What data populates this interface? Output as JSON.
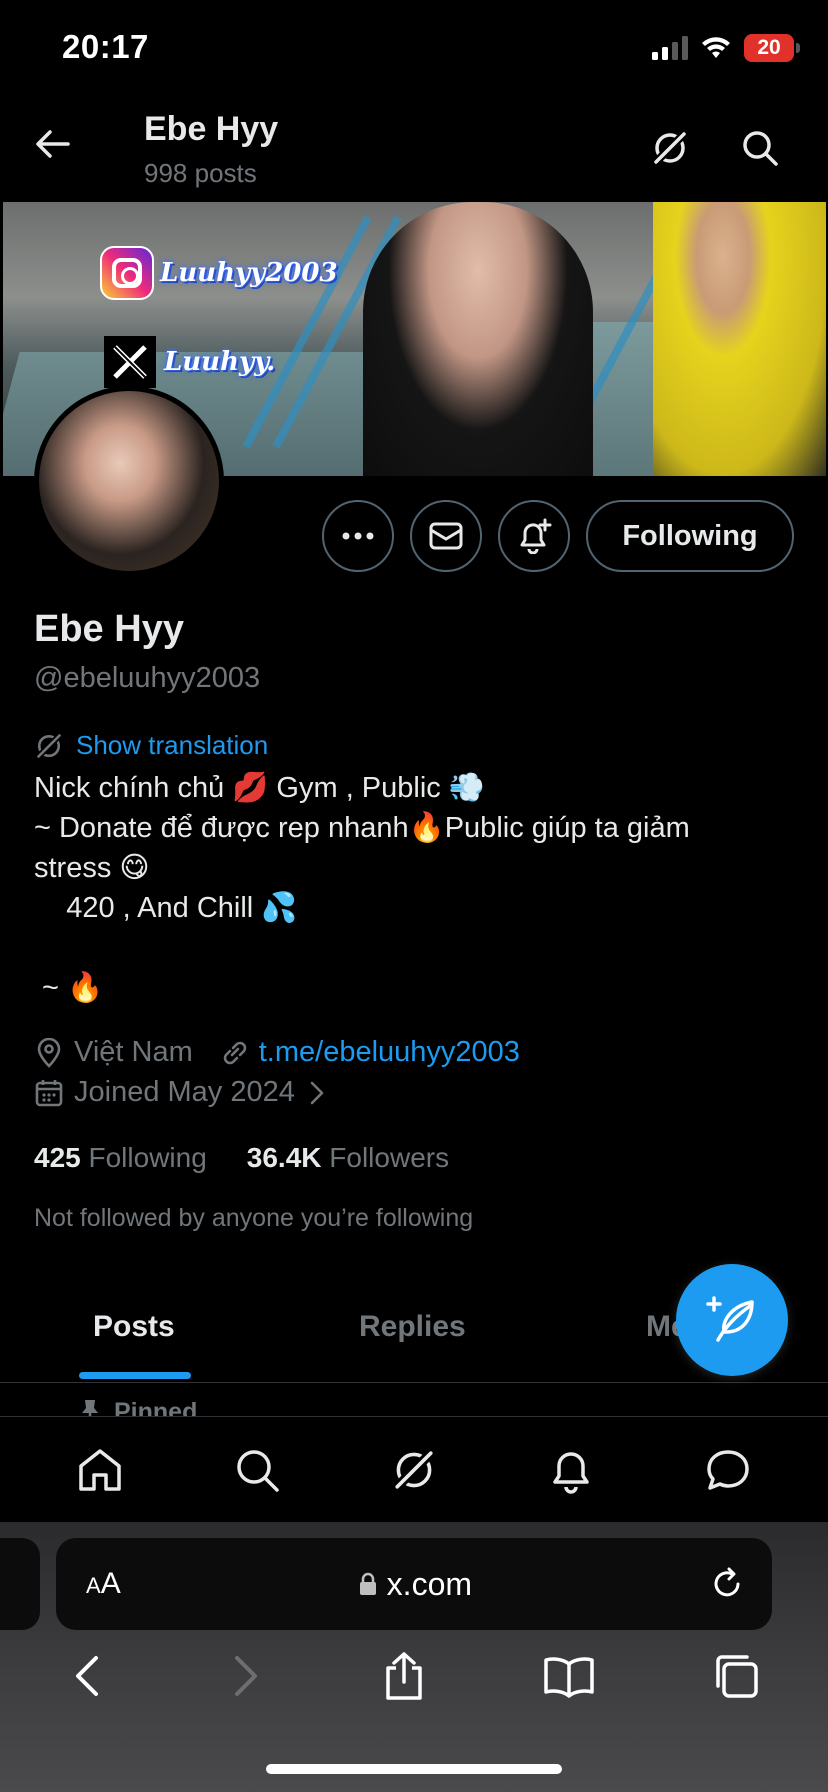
{
  "status_bar": {
    "time": "20:17",
    "battery": "20"
  },
  "header": {
    "title": "Ebe Hyy",
    "subtitle": "998 posts"
  },
  "banner": {
    "instagram_handle": "Luuhyy2003",
    "x_handle": "Luuhyy."
  },
  "actions": {
    "following_label": "Following"
  },
  "profile": {
    "name": "Ebe Hyy",
    "handle": "@ebeluuhyy2003",
    "translation_label": "Show translation",
    "bio": {
      "line1": "Nick chính chủ 💋 Gym , Public 💨",
      "line2": "~ Donate để được rep nhanh🔥Public giúp ta giảm",
      "line3": "stress 😋",
      "line4": "    420 , And Chill 💦",
      "line5": " ~ 🔥"
    },
    "location": "Việt Nam",
    "link": "t.me/ebeluuhyy2003",
    "joined": "Joined May 2024",
    "following_count": "425",
    "following_label": "Following",
    "followers_count": "36.4K",
    "followers_label": "Followers",
    "not_followed": "Not followed by anyone you’re following"
  },
  "tabs": {
    "posts": "Posts",
    "replies": "Replies",
    "more": "Me"
  },
  "pinned_label": "Pinned",
  "browser": {
    "aa_big": "A",
    "aa_small": "A",
    "url": "x.com"
  },
  "colors": {
    "accent": "#1d9bf0",
    "background": "#000000",
    "muted": "#71767b",
    "battery": "#e0312a"
  }
}
